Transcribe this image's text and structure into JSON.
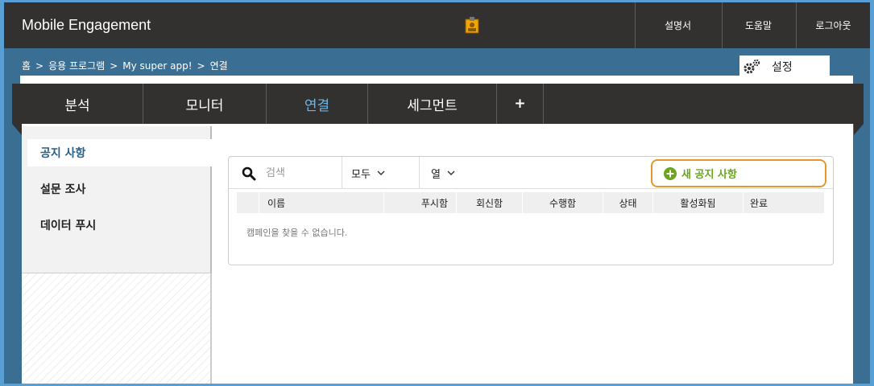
{
  "header": {
    "app_title": "Mobile Engagement",
    "links": [
      "설명서",
      "도움말",
      "로그아웃"
    ]
  },
  "breadcrumb": {
    "items": [
      "홈",
      "응용 프로그램",
      "My super app!",
      "연결"
    ],
    "separator": ">"
  },
  "settings": {
    "label": "설정"
  },
  "mainnav": {
    "tabs": [
      {
        "label": "분석",
        "active": false
      },
      {
        "label": "모니터",
        "active": false
      },
      {
        "label": "연결",
        "active": true
      },
      {
        "label": "세그먼트",
        "active": false
      },
      {
        "label": "+",
        "active": false
      }
    ]
  },
  "sidenav": {
    "items": [
      {
        "label": "공지 사항",
        "active": true
      },
      {
        "label": "설문 조사",
        "active": false
      },
      {
        "label": "데이터 푸시",
        "active": false
      }
    ]
  },
  "toolbar": {
    "search_placeholder": "검색",
    "filter_label": "모두",
    "columns_label": "열",
    "new_button_label": "새 공지 사항"
  },
  "table": {
    "columns": [
      "이름",
      "푸시함",
      "회신함",
      "수행함",
      "상태",
      "활성화됨",
      "완료"
    ],
    "empty_message": "캠페인을 찾을 수 없습니다."
  },
  "colors": {
    "header_bg": "#333130",
    "frame_bg": "#3a6e93",
    "active_tab": "#6db5e3",
    "active_side": "#2a5f86",
    "new_button_border": "#e8962a",
    "new_button_text": "#6aa51e"
  }
}
